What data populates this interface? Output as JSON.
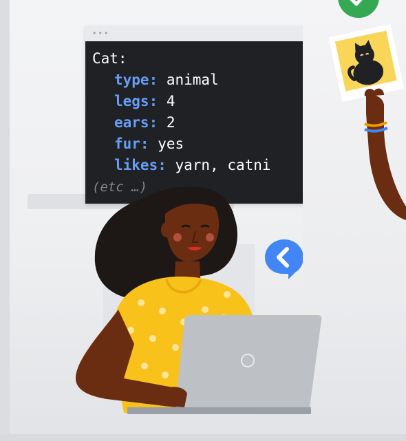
{
  "code_window": {
    "titlebar_dots": "•••",
    "lines": {
      "object_name": "Cat:",
      "type_key": "type:",
      "type_value": " animal",
      "legs_key": "legs:",
      "legs_value": " 4",
      "ears_key": "ears:",
      "ears_value": " 2",
      "fur_key": "fur:",
      "fur_value": " yes",
      "likes_key": "likes:",
      "likes_value": " yarn, catni",
      "etc_comment": "(etc …)"
    }
  },
  "colors": {
    "code_background": "#202124",
    "code_key": "#669df6",
    "shirt": "#f9c21b",
    "skin": "#6b2d12",
    "hair": "#1d1716",
    "laptop": "#bdc1c6",
    "speech_bubble": "#4285f4",
    "photo_card": "#f9d65a",
    "check_badge": "#34a853"
  },
  "icons": {
    "speech_bubble": "back-chevron-icon",
    "check_badge": "check-icon",
    "laptop_logo": "circle-icon",
    "photo": "cat-photo-icon"
  }
}
